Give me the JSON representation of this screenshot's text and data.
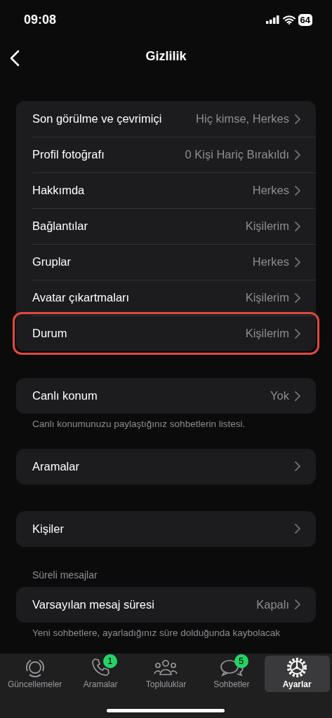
{
  "status_bar": {
    "time": "09:08",
    "battery": "64"
  },
  "nav": {
    "title": "Gizlilik"
  },
  "sections": [
    {
      "rows": [
        {
          "label": "Son görülme ve çevrimiçi",
          "value": "Hiç kimse, Herkes",
          "highlighted": false
        },
        {
          "label": "Profil fotoğrafı",
          "value": "0 Kişi Hariç Bırakıldı",
          "highlighted": false
        },
        {
          "label": "Hakkımda",
          "value": "Herkes",
          "highlighted": false
        },
        {
          "label": "Bağlantılar",
          "value": "Kişilerim",
          "highlighted": false
        },
        {
          "label": "Gruplar",
          "value": "Herkes",
          "highlighted": false
        },
        {
          "label": "Avatar çıkartmaları",
          "value": "Kişilerim",
          "highlighted": false
        },
        {
          "label": "Durum",
          "value": "Kişilerim",
          "highlighted": true
        }
      ]
    },
    {
      "rows": [
        {
          "label": "Canlı konum",
          "value": "Yok",
          "highlighted": false
        }
      ],
      "footer": "Canlı konumunuzu paylaştığınız sohbetlerin listesi."
    },
    {
      "rows": [
        {
          "label": "Aramalar",
          "highlighted": false
        }
      ]
    },
    {
      "rows": [
        {
          "label": "Kişiler",
          "highlighted": false
        }
      ]
    },
    {
      "header": "Süreli mesajlar",
      "rows": [
        {
          "label": "Varsayılan mesaj süresi",
          "value": "Kapalı",
          "highlighted": false
        }
      ],
      "footer": "Yeni sohbetlere, ayarladığınız süre dolduğunda kaybolacak"
    }
  ],
  "tab_bar": [
    {
      "label": "Güncellemeler",
      "kind": "updates",
      "selected": false
    },
    {
      "label": "Aramalar",
      "kind": "calls",
      "badge": "1",
      "selected": false
    },
    {
      "label": "Topluluklar",
      "kind": "communities",
      "selected": false
    },
    {
      "label": "Sohbetler",
      "kind": "chats",
      "badge": "5",
      "selected": false
    },
    {
      "label": "Ayarlar",
      "kind": "settings",
      "selected": true
    }
  ]
}
